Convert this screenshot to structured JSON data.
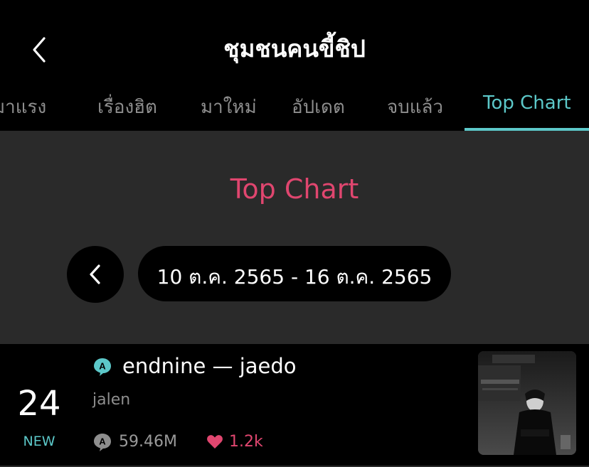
{
  "header": {
    "title": "ชุมชนคนขี้ชิป"
  },
  "tabs": [
    {
      "label": "มาแรง"
    },
    {
      "label": "เรื่องฮิต"
    },
    {
      "label": "มาใหม่"
    },
    {
      "label": "อัปเดต"
    },
    {
      "label": "จบแล้ว"
    },
    {
      "label": "Top Chart"
    }
  ],
  "chart_header": {
    "title": "Top Chart",
    "date_range": "10 ต.ค. 2565 - 16 ต.ค. 2565"
  },
  "entry": {
    "rank": "24",
    "status": "NEW",
    "title": "endnine — jaedo",
    "author": "jalen",
    "views": "59.46M",
    "likes": "1.2k"
  },
  "colors": {
    "accent_teal": "#5cc8c9",
    "accent_pink": "#e0466f",
    "panel_bg": "#2a2a2a"
  },
  "icons": [
    "back-chevron-icon",
    "prev-week-icon",
    "author-badge-icon",
    "views-icon",
    "heart-icon"
  ]
}
